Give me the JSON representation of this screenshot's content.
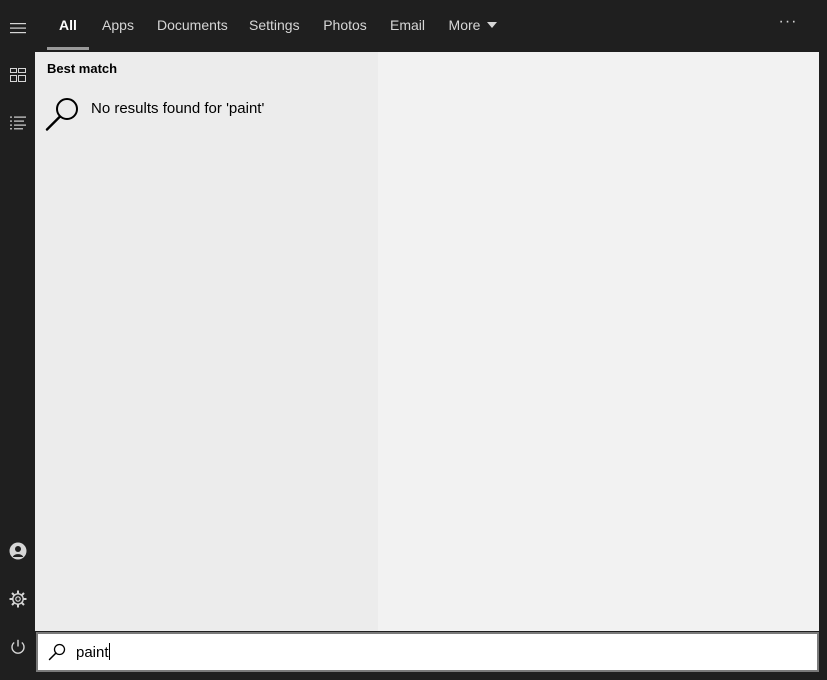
{
  "tabs": [
    {
      "label": "All",
      "active": true
    },
    {
      "label": "Apps"
    },
    {
      "label": "Documents"
    },
    {
      "label": "Settings"
    },
    {
      "label": "Photos"
    },
    {
      "label": "Email"
    },
    {
      "label": "More"
    }
  ],
  "overflow_icon": "ellipsis-icon",
  "rail": {
    "top_icons": [
      "hamburger-menu-icon",
      "home-tiles-icon",
      "documents-list-icon"
    ],
    "bottom_icons": [
      "account-icon",
      "settings-gear-icon",
      "power-icon"
    ]
  },
  "results": {
    "section_title": "Best match",
    "no_results_text": "No results found for 'paint'",
    "icon": "search-icon"
  },
  "search": {
    "value": "paint",
    "icon": "search-icon"
  },
  "colors": {
    "chrome": "#1f1f1f",
    "left_pane": "#ececec",
    "right_pane": "#f2f2f2",
    "active_underline": "#9a9a9a"
  }
}
